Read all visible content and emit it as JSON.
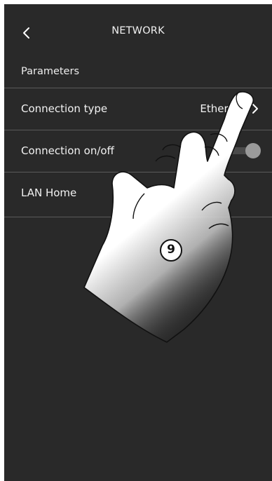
{
  "header": {
    "title": "NETWORK",
    "back_icon": "chevron-left-icon"
  },
  "section": {
    "label": "Parameters"
  },
  "rows": [
    {
      "label": "Connection type",
      "value": "Ethernet",
      "icon": "chevron-right-icon"
    },
    {
      "label": "Connection on/off",
      "toggle_on": true
    },
    {
      "label": "LAN Home"
    }
  ],
  "annotation": {
    "step_number": "9"
  },
  "colors": {
    "background": "#292929",
    "divider": "#5a5a5a",
    "text": "#f2f2f2",
    "toggle_knob": "#9a9a9a"
  }
}
